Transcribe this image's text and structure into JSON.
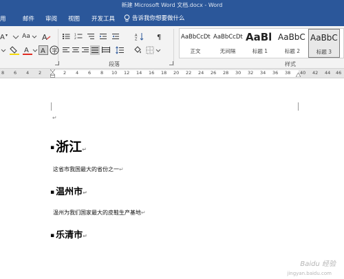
{
  "window": {
    "title": "新建 Microsoft Word 文档.docx - Word"
  },
  "menu": {
    "tabs": [
      "用",
      "邮件",
      "审阅",
      "视图",
      "开发工具"
    ],
    "tell_me": "告诉我你想要做什么"
  },
  "ribbon": {
    "font_size_menu_label": "Aa",
    "groups": {
      "paragraph": "段落",
      "styles": "样式"
    },
    "styles": [
      {
        "sample": "AaBbCcDt",
        "name": "正文"
      },
      {
        "sample": "AaBbCcDt",
        "name": "无间隔"
      },
      {
        "sample": "AaBl",
        "name": "标题 1"
      },
      {
        "sample": "AaBbC",
        "name": "标题 2"
      },
      {
        "sample": "AaBbC",
        "name": "标题 3"
      }
    ]
  },
  "ruler": {
    "ticks": [
      "8",
      "6",
      "4",
      "2",
      "2",
      "4",
      "6",
      "8",
      "10",
      "12",
      "14",
      "16",
      "18",
      "20",
      "22",
      "24",
      "26",
      "28",
      "30",
      "32",
      "34",
      "36",
      "38",
      "40",
      "42",
      "44",
      "46"
    ]
  },
  "document": {
    "empty_mark": "↵",
    "heading1": "浙江",
    "para1": "这省市我国最大的省份之一",
    "heading2": "温州市",
    "para2": "温州为我们国家最大的皮鞋生产基地",
    "heading3": "乐清市",
    "para_mark": "↵"
  },
  "watermark": {
    "main": "Baidu 经验",
    "sub": "jingyan.baidu.com"
  },
  "colors": {
    "titlebar": "#2b579a",
    "ribbon": "#f3f3f3",
    "ruler": "#e6e6e6"
  }
}
